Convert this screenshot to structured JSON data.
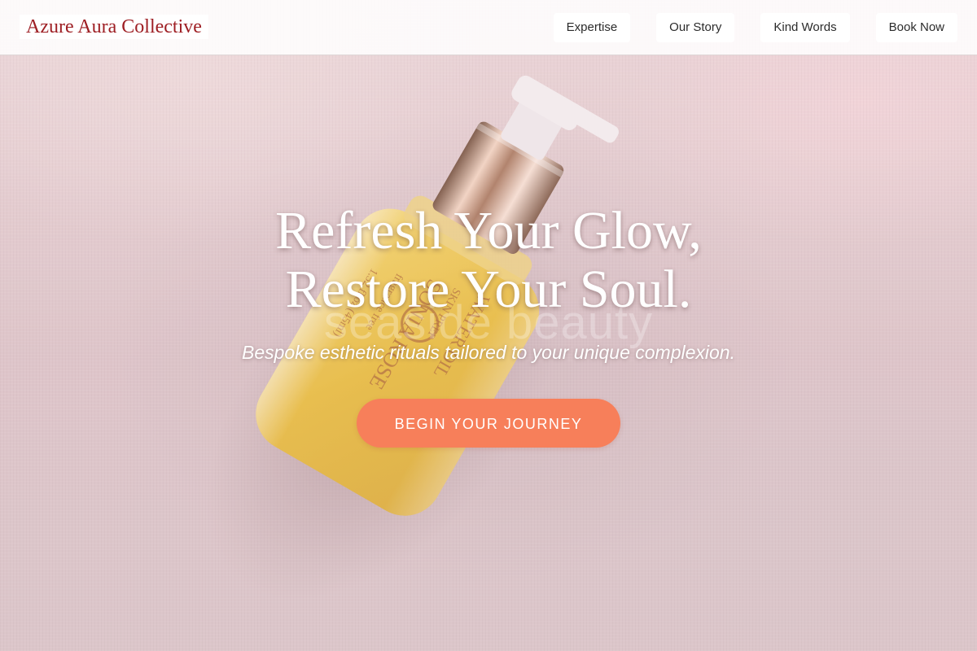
{
  "site": {
    "brand_name": "Azure Aura Collective"
  },
  "nav": {
    "items": [
      {
        "label": "Expertise"
      },
      {
        "label": "Our Story"
      },
      {
        "label": "Kind Words"
      },
      {
        "label": "Book Now"
      }
    ]
  },
  "hero": {
    "title_line_1": "Refresh Your Glow,",
    "title_line_2": "Restore Your Soul.",
    "watermark_text": "seaside beauty",
    "subtitle": "Bespoke esthetic rituals tailored to your unique complexion.",
    "cta_label": "BEGIN YOUR JOURNEY",
    "background_image": "product-serum-bottle-photo"
  },
  "colors": {
    "brand_red": "#9e1f24",
    "cta_coral": "#f77f5a",
    "hero_pink": "#e7d3d4",
    "header_bg": "#ffffff"
  }
}
